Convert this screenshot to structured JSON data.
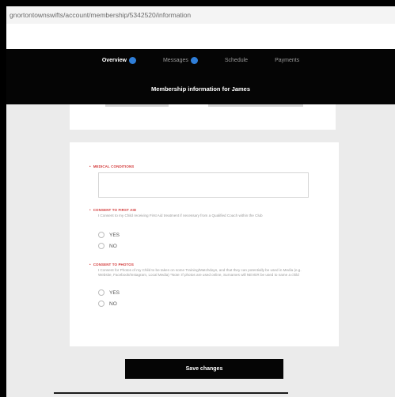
{
  "browser": {
    "url": "gnortontownswifts/account/membership/5342520/information"
  },
  "nav": {
    "tabs": [
      {
        "label": "Overview",
        "active": true,
        "badge": true
      },
      {
        "label": "Messages",
        "active": false,
        "badge": true
      },
      {
        "label": "Schedule",
        "active": false,
        "badge": false
      },
      {
        "label": "Payments",
        "active": false,
        "badge": false
      }
    ],
    "title": "Membership information for James"
  },
  "form": {
    "medical": {
      "label": "MEDICAL CONDITIONS",
      "value": ""
    },
    "first_aid": {
      "label": "CONSENT TO FIRST AID",
      "help": "I Consent to my Child receiving First Aid treatment if necessary from a Qualified Coach within the Club",
      "options": [
        "YES",
        "NO"
      ]
    },
    "photos": {
      "label": "CONSENT TO PHOTOS",
      "help": "I Consent for Photos of my Child to be taken on some Training/Matchdays, and that they can potentially be used in Media (e.g. Website, Facebook/Instagram, Local Media) *Note: If photos are used online, Surnames will NEVER be used to name a child",
      "options": [
        "YES",
        "NO"
      ]
    },
    "save_label": "Save changes"
  },
  "colors": {
    "accent": "#d33a3a",
    "badge": "#2f7ed8",
    "nav_bg": "#050505"
  }
}
